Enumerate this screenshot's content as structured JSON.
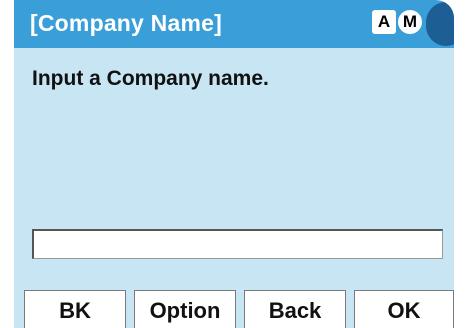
{
  "title_bar": {
    "title": "[Company Name]",
    "indicator_a": "A",
    "indicator_m": "M"
  },
  "body": {
    "prompt": "Input a Company name.",
    "input_value": ""
  },
  "softkeys": {
    "bk": "BK",
    "option": "Option",
    "back": "Back",
    "ok": "OK"
  },
  "colors": {
    "title_bar": "#3a9fd8",
    "screen_background": "#c8e5f4",
    "pill": "#1d5f95"
  }
}
